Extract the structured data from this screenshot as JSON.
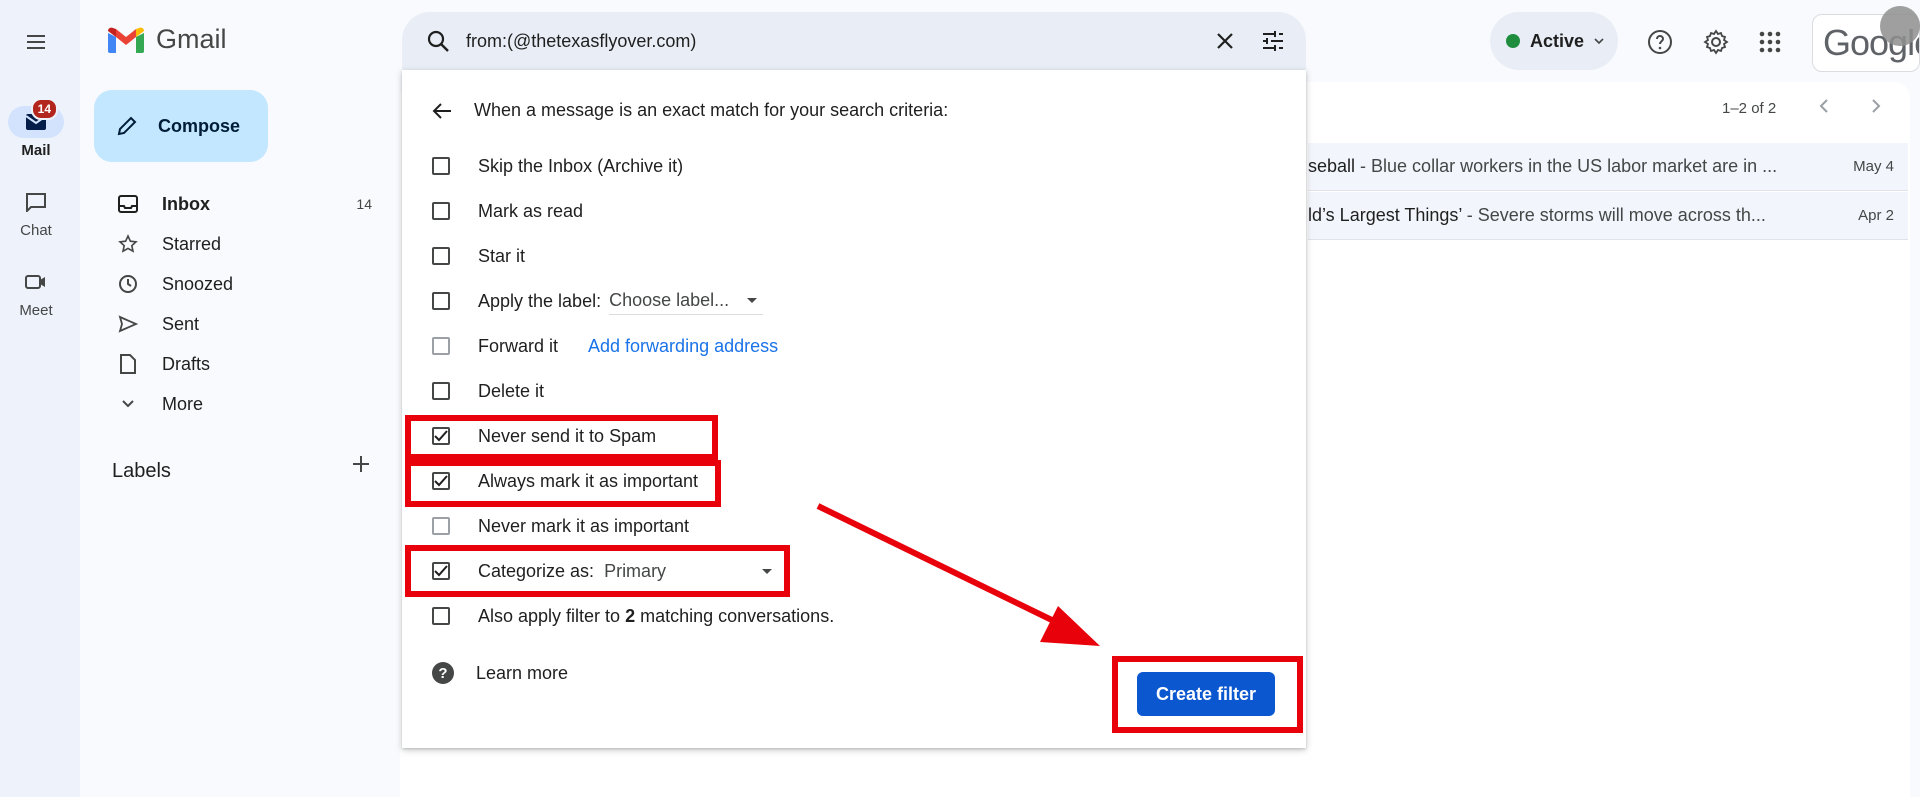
{
  "app": {
    "name": "Gmail"
  },
  "rail": {
    "items": [
      {
        "label": "Mail",
        "badge": "14"
      },
      {
        "label": "Chat"
      },
      {
        "label": "Meet"
      }
    ]
  },
  "compose": {
    "label": "Compose"
  },
  "nav": {
    "items": [
      {
        "label": "Inbox",
        "count": "14"
      },
      {
        "label": "Starred"
      },
      {
        "label": "Snoozed"
      },
      {
        "label": "Sent"
      },
      {
        "label": "Drafts"
      },
      {
        "label": "More"
      }
    ],
    "labels_header": "Labels"
  },
  "search": {
    "query": "from:(@thetexasflyover.com)"
  },
  "status": {
    "label": "Active",
    "color": "#1e8e3e"
  },
  "brand": {
    "google_text": "Google"
  },
  "mail_list": {
    "pager": "1–2 of 2",
    "rows": [
      {
        "subject_fragment": "seball",
        "snippet": " - Blue collar workers in the US labor market are in ...",
        "date": "May 4"
      },
      {
        "subject_fragment": "ld’s Largest Things’",
        "snippet": " - Severe storms will move across th...",
        "date": "Apr 2"
      }
    ]
  },
  "filter_dialog": {
    "header": "When a message is an exact match for your search criteria:",
    "options": {
      "skip_inbox": "Skip the Inbox (Archive it)",
      "mark_read": "Mark as read",
      "star_it": "Star it",
      "apply_label": "Apply the label:",
      "apply_label_value": "Choose label...",
      "forward_it": "Forward it",
      "forward_link": "Add forwarding address",
      "delete_it": "Delete it",
      "never_spam": "Never send it to Spam",
      "always_important": "Always mark it as important",
      "never_important": "Never mark it as important",
      "categorize": "Categorize as:",
      "categorize_value": "Primary",
      "also_apply_pre": "Also apply filter to ",
      "also_apply_count": "2",
      "also_apply_post": " matching conversations."
    },
    "checked": {
      "skip_inbox": false,
      "mark_read": false,
      "star_it": false,
      "apply_label": false,
      "forward_it": false,
      "delete_it": false,
      "never_spam": true,
      "always_important": true,
      "never_important": false,
      "categorize": true,
      "also_apply": false
    },
    "learn_more": "Learn more",
    "create_button": "Create filter"
  },
  "annotation": {
    "color": "#e8000b"
  }
}
